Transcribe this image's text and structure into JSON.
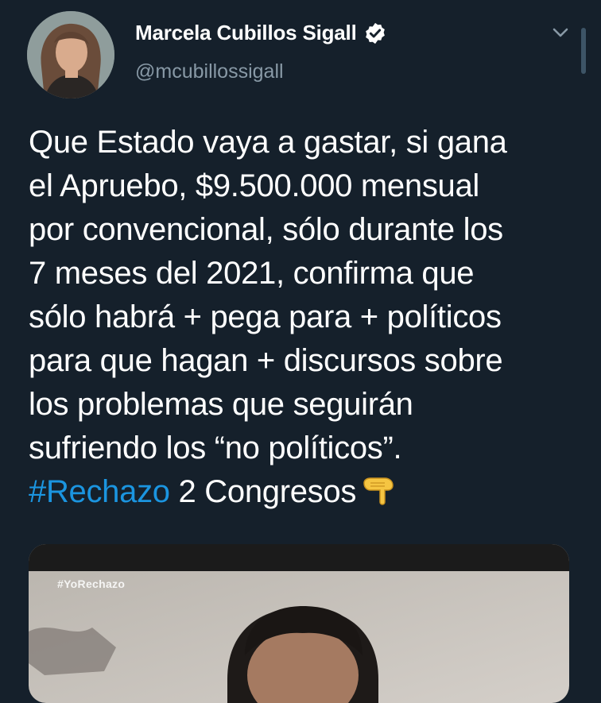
{
  "author": {
    "name": "Marcela Cubillos Sigall",
    "handle": "@mcubillossigall",
    "verified": true
  },
  "tweet": {
    "body": "Que Estado vaya a gastar, si gana\nel Apruebo, $9.500.000 mensual\npor convencional, sólo durante los\n7 meses del 2021, confirma que\nsólo habrá + pega para + políticos\npara que hagan + discursos sobre\nlos problemas que seguirán\nsufriendo los “no políticos”.",
    "hashtag": "#Rechazo",
    "tail": " 2 Congresos"
  },
  "media": {
    "overlay_tag": "#YoRechazo"
  },
  "icons": {
    "verified": "verified-badge-icon",
    "more": "chevron-down-icon",
    "emoji": "backhand-index-pointing-down-icon"
  },
  "colors": {
    "background": "#15202b",
    "text": "#ffffff",
    "secondary": "#8899a6",
    "link": "#1b95e0"
  }
}
